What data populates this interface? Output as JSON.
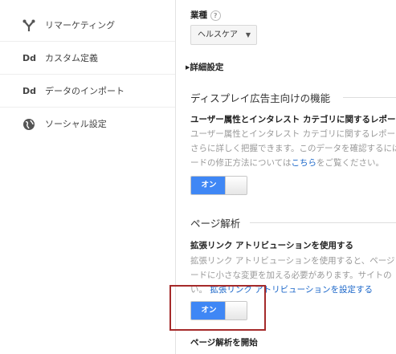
{
  "sidebar": {
    "items": [
      {
        "icon": "remarketing-icon",
        "label": "リマーケティング"
      },
      {
        "icon": "dd-icon",
        "icon_text": "Dd",
        "label": "カスタム定義"
      },
      {
        "icon": "dd-icon",
        "icon_text": "Dd",
        "label": "データのインポート"
      },
      {
        "icon": "globe-icon",
        "label": "ソーシャル設定"
      }
    ]
  },
  "industry": {
    "label": "業種",
    "help": "?",
    "selected": "ヘルスケア"
  },
  "advanced": {
    "label": "詳細設定"
  },
  "display_features": {
    "heading": "ディスプレイ広告主向けの機能",
    "subheading": "ユーザー属性とインタレスト カテゴリに関するレポート",
    "desc_line1": "ユーザー属性とインタレスト カテゴリに関するレポート",
    "desc_line2": "さらに詳しく把握できます。このデータを確認するには",
    "desc_line3_pre": "ードの修正方法については",
    "desc_line3_link": "こちら",
    "desc_line3_post": "をご覧ください。",
    "toggle": {
      "label": "オン",
      "state": "on"
    }
  },
  "page_analytics": {
    "heading": "ページ解析",
    "subheading": "拡張リンク アトリビューションを使用する",
    "desc_line1": "拡張リンク アトリビューションを使用すると、ページ",
    "desc_line2": "ードに小さな変更を加える必要があります。サイトの",
    "desc_line3_pre": "い。",
    "desc_line3_link": "拡張リンク アトリビューションを設定する",
    "toggle": {
      "label": "オン",
      "state": "on"
    },
    "start_label": "ページ解析を開始"
  },
  "colors": {
    "toggle_on": "#3f87f5",
    "link": "#1a66c9",
    "highlight_border": "#a52a2a"
  }
}
